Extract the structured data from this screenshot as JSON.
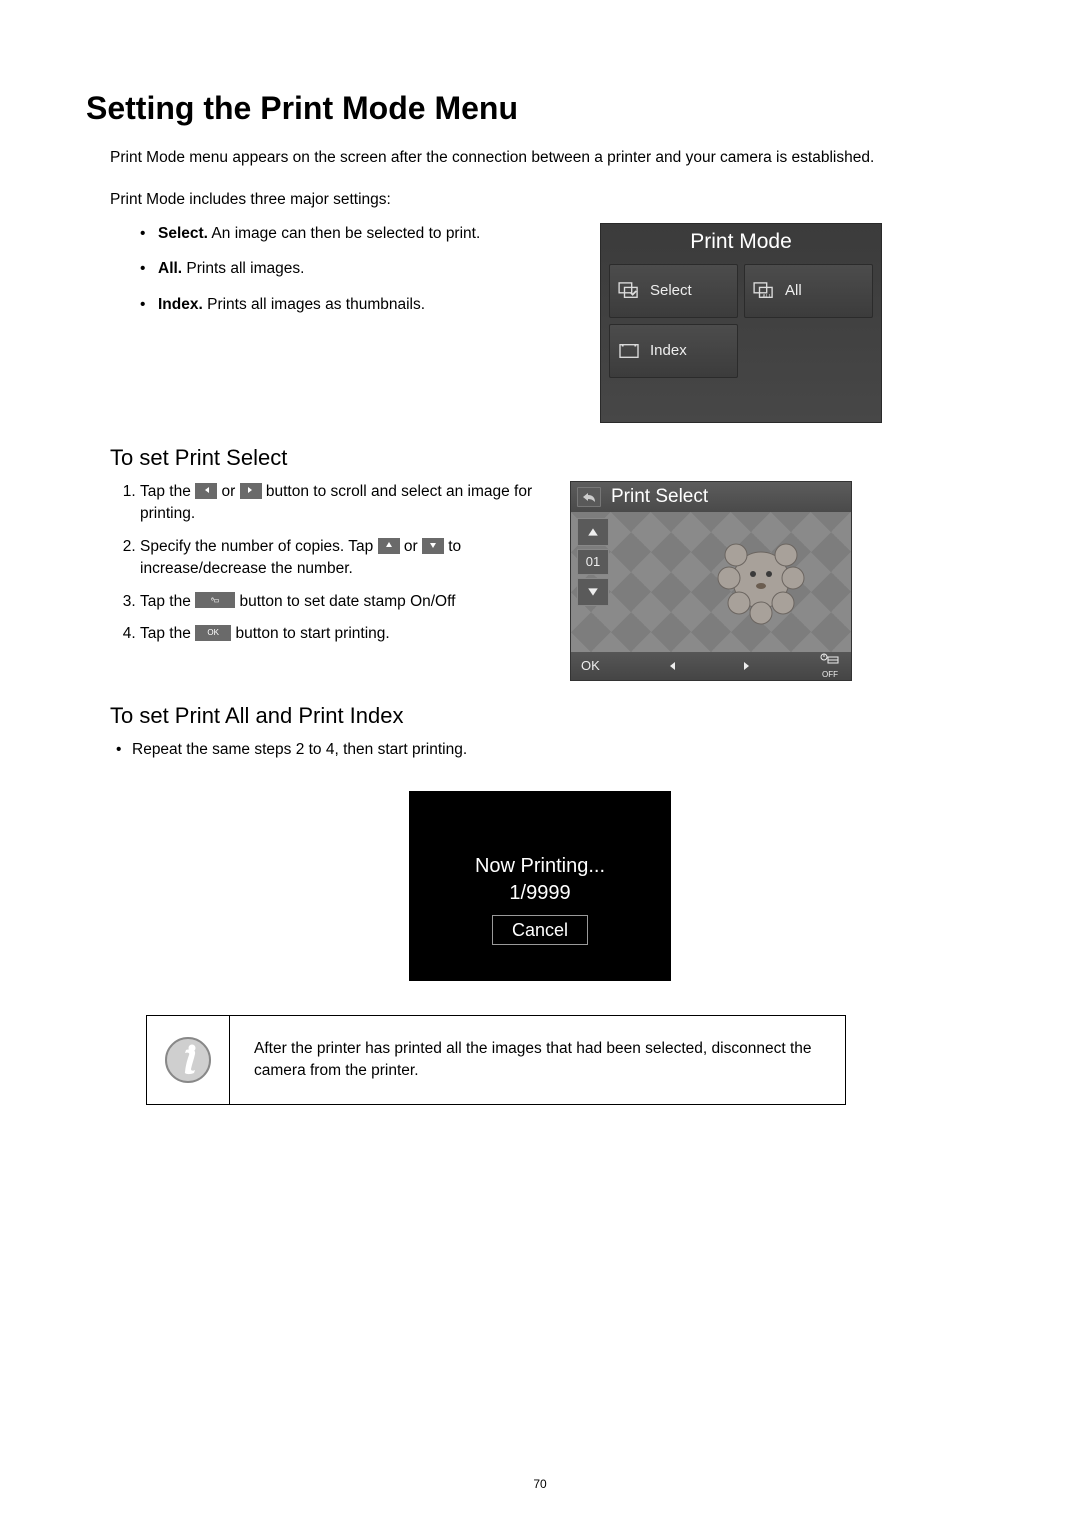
{
  "title": "Setting the Print Mode Menu",
  "intro": "Print Mode menu appears on the screen after the connection between a printer and your camera is established.",
  "sub": "Print Mode includes three major settings:",
  "bullets": [
    {
      "bold": "Select.",
      "text": " An image can then be selected to print."
    },
    {
      "bold": "All.",
      "text": " Prints all images."
    },
    {
      "bold": "Index.",
      "text": " Prints all images as thumbnails."
    }
  ],
  "screen1": {
    "title": "Print Mode",
    "options": {
      "select": "Select",
      "all": "All",
      "index": "Index"
    }
  },
  "heading_select": "To set Print Select",
  "steps": {
    "s1a": "Tap the ",
    "s1b": " or ",
    "s1c": " button to scroll and select an image for printing.",
    "s2a": "Specify the number of copies. Tap ",
    "s2b": " or ",
    "s2c": " to increase/decrease the number.",
    "s3a": "Tap the ",
    "s3b": " button to set date stamp On/Off",
    "s4a": "Tap the ",
    "s4b": " button to start printing.",
    "ok_label": "OK"
  },
  "screen2": {
    "title": "Print Select",
    "count": "01",
    "ok": "OK",
    "date_on": "OFF"
  },
  "heading_all": "To set Print All and Print Index",
  "repeat_step": "Repeat the same steps 2 to 4, then start printing.",
  "screen3": {
    "line1": "Now Printing...",
    "line2": "1/9999",
    "cancel": "Cancel"
  },
  "note": "After the printer has printed all the images that had been selected, disconnect the camera from the printer.",
  "page_number": "70"
}
